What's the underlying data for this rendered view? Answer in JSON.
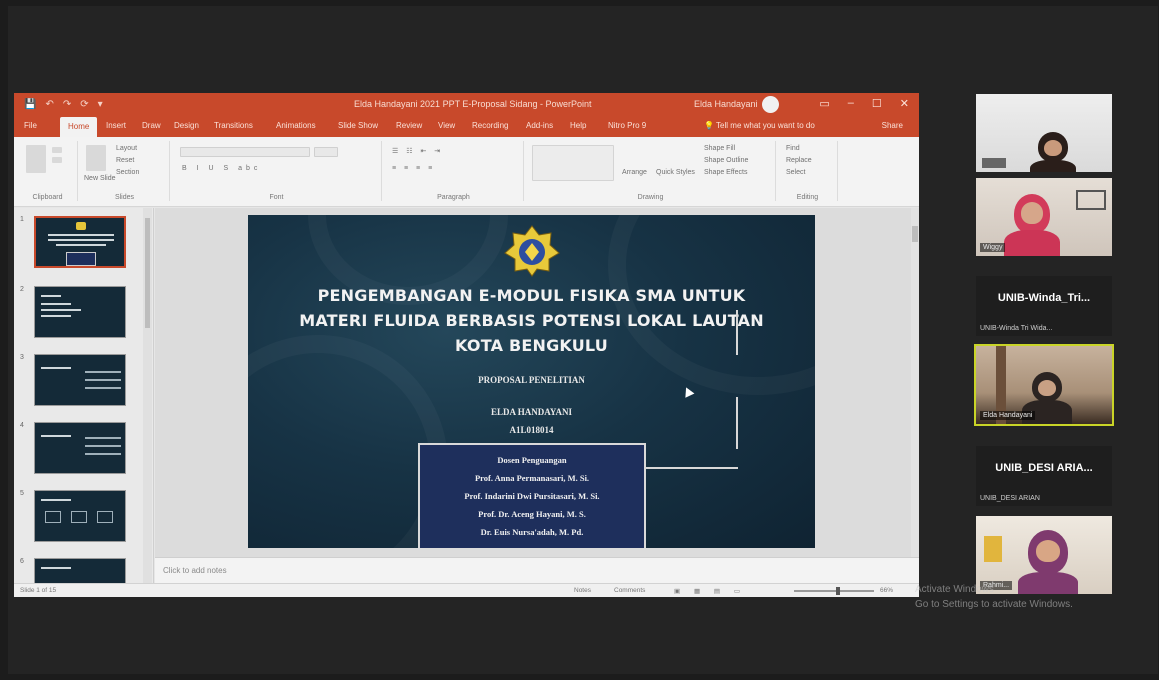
{
  "powerpoint": {
    "quick_access": [
      "💾",
      "↶",
      "↷",
      "⟳",
      "▾"
    ],
    "document_title": "Elda Handayani 2021 PPT E-Proposal Sidang - PowerPoint",
    "user_name": "Elda Handayani",
    "window_controls": [
      "▭",
      "–",
      "☐",
      "✕"
    ],
    "tabs": [
      "File",
      "Home",
      "Insert",
      "Draw",
      "Design",
      "Transitions",
      "Animations",
      "Slide Show",
      "Review",
      "View",
      "Recording",
      "Add-ins",
      "Help",
      "Nitro Pro 9"
    ],
    "active_tab": "Home",
    "tell_me": "Tell me what you want to do",
    "share": "Share",
    "ribbon_groups": [
      "Clipboard",
      "Slides",
      "Font",
      "Paragraph",
      "Drawing",
      "Editing"
    ],
    "ribbon_items": {
      "layout": "Layout",
      "reset": "Reset",
      "section": "Section",
      "new_slide": "New Slide",
      "arrange": "Arrange",
      "quick_styles": "Quick Styles",
      "shape_fill": "Shape Fill",
      "shape_outline": "Shape Outline",
      "shape_effects": "Shape Effects",
      "find": "Find",
      "replace": "Replace",
      "select": "Select"
    },
    "thumbnails": [
      "1",
      "2",
      "3",
      "4",
      "5",
      "6"
    ],
    "notes_placeholder": "Click to add notes",
    "status": {
      "slide_info": "Slide 1 of 15",
      "notes": "Notes",
      "comments": "Comments",
      "zoom": "66%"
    }
  },
  "slide": {
    "title": "PENGEMBANGAN E-MODUL FISIKA SMA UNTUK MATERI FLUIDA BERBASIS POTENSI LOKAL LAUTAN KOTA BENGKULU",
    "subtitle": "PROPOSAL PENELITIAN",
    "author": "ELDA HANDAYANI",
    "student_id": "A1L018014",
    "advisors_heading": "Dosen Penguangan",
    "advisors": [
      "Prof. Anna Permanasari, M. Si.",
      "Prof. Indarini Dwi Pursitasari, M. Si.",
      "Prof. Dr. Aceng Hayani, M. S.",
      "Dr. Euis Nursa'adah, M. Pd."
    ]
  },
  "participants": [
    {
      "type": "video",
      "name": ""
    },
    {
      "type": "video",
      "name": "Wiggy"
    },
    {
      "type": "name",
      "title": "UNIB-Winda_Tri...",
      "name": "UNIB-Winda Tri Wida..."
    },
    {
      "type": "video",
      "name": "Elda Handayani",
      "active": true
    },
    {
      "type": "name",
      "title": "UNIB_DESI ARIA...",
      "name": "UNIB_DESI ARIAN"
    },
    {
      "type": "video",
      "name": "Rahmi..."
    }
  ],
  "watermark": {
    "line1": "Activate Windows",
    "line2": "Go to Settings to activate Windows."
  }
}
